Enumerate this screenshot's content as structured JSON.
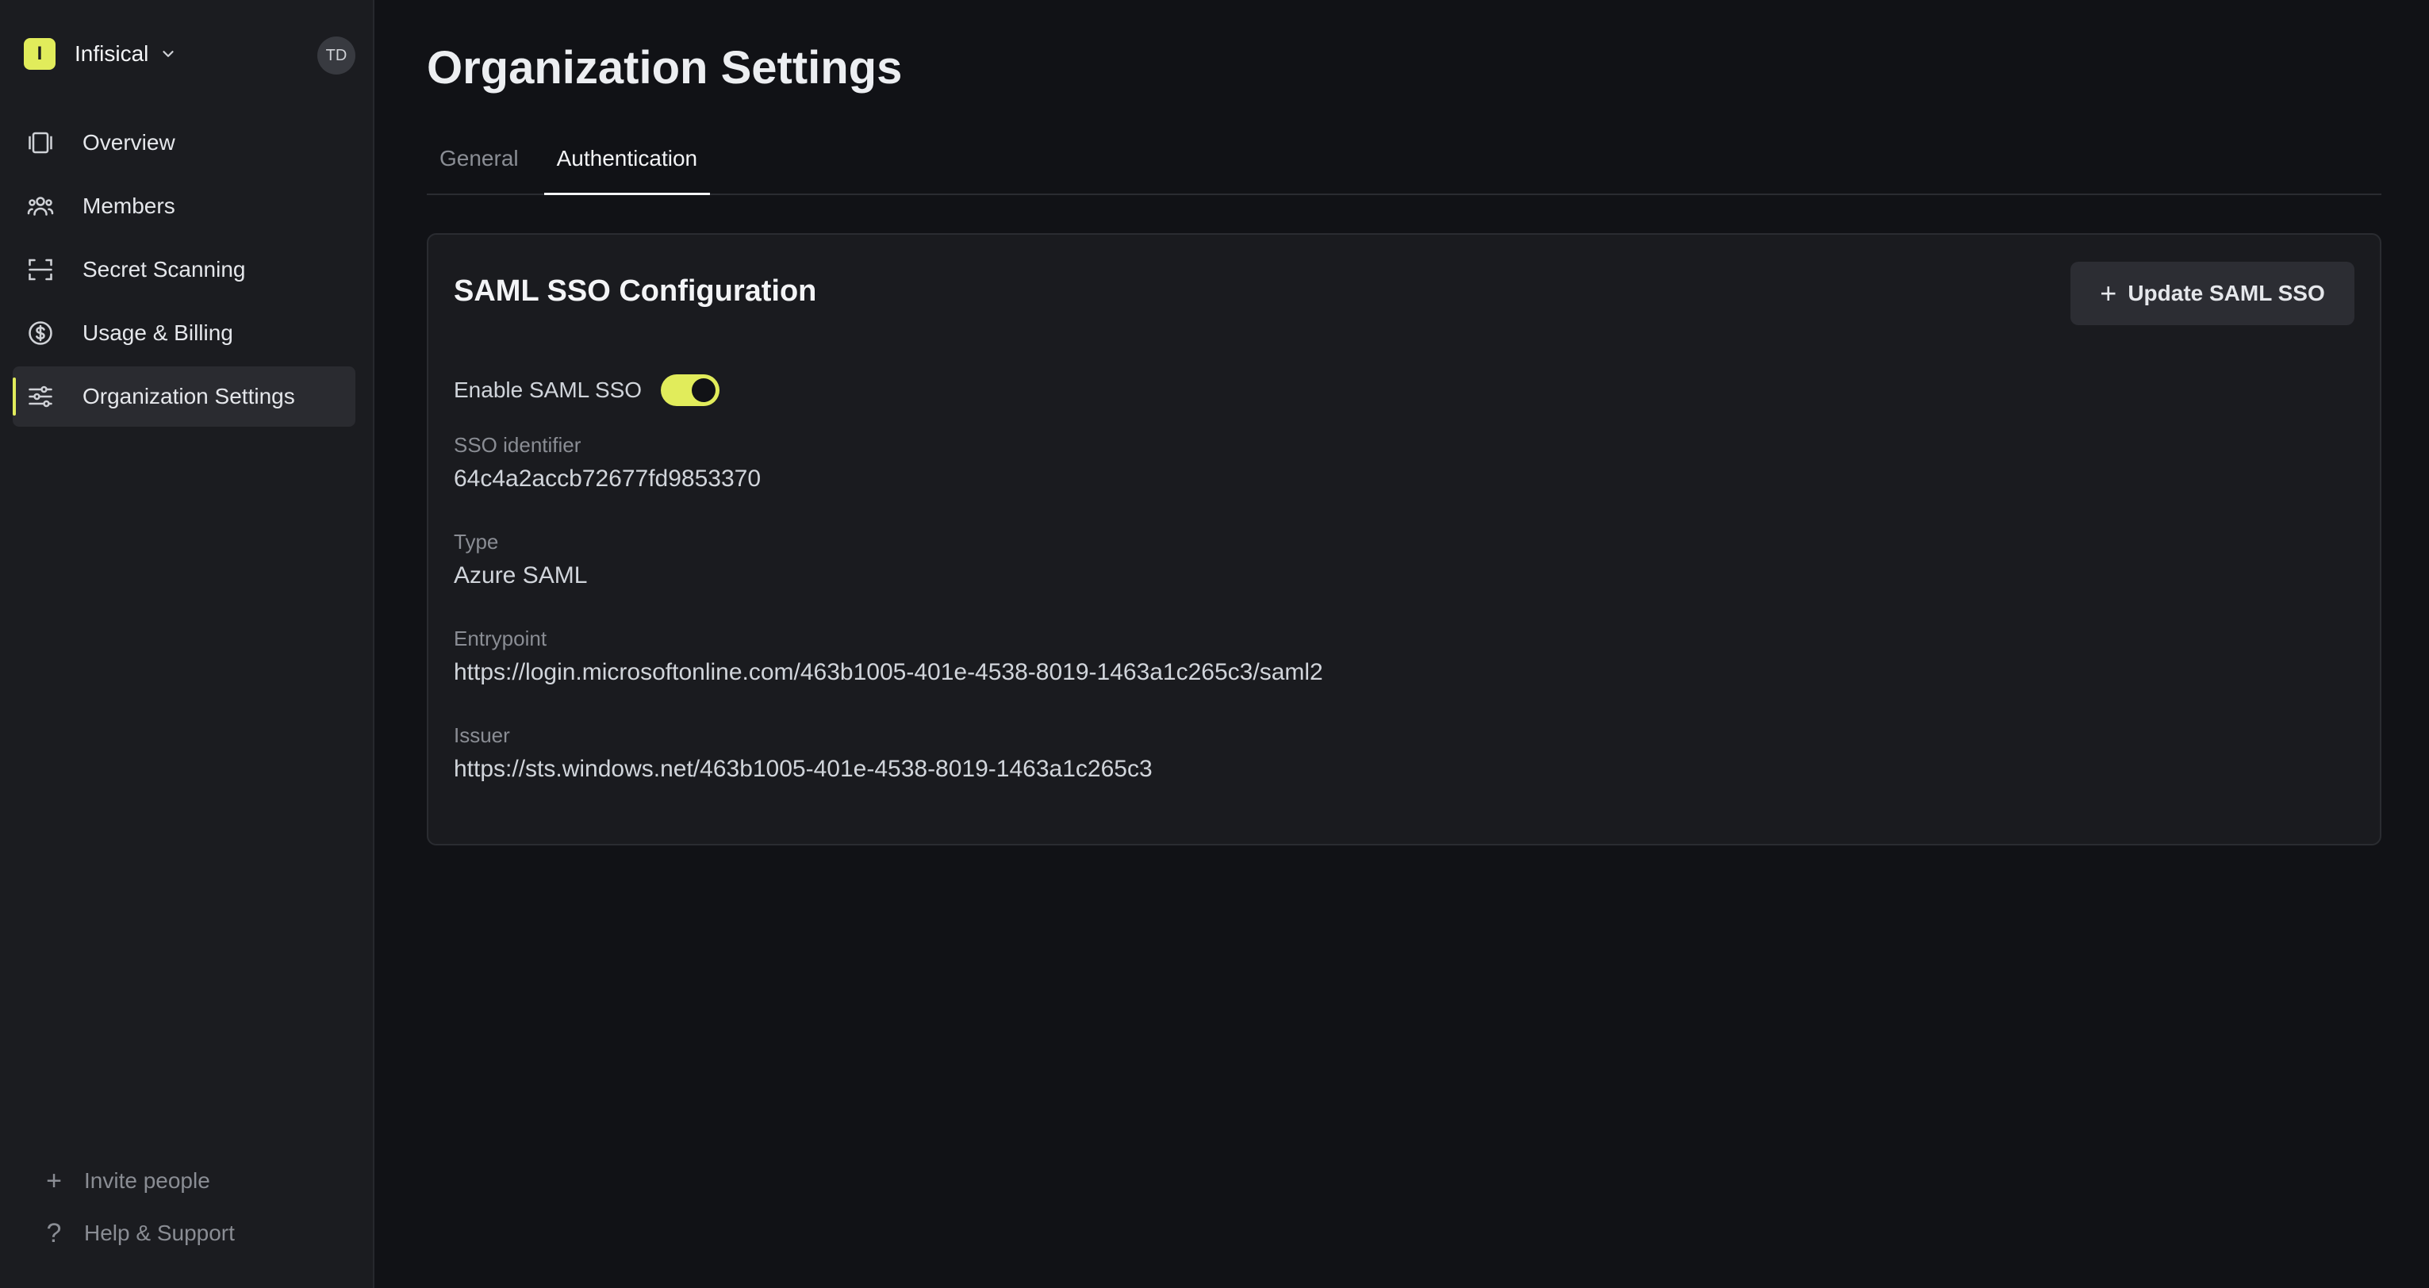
{
  "sidebar": {
    "org": {
      "badge": "I",
      "name": "Infisical"
    },
    "avatar": "TD",
    "items": [
      {
        "label": "Overview",
        "icon": "overview-icon"
      },
      {
        "label": "Members",
        "icon": "members-icon"
      },
      {
        "label": "Secret Scanning",
        "icon": "scan-icon"
      },
      {
        "label": "Usage & Billing",
        "icon": "dollar-icon"
      },
      {
        "label": "Organization Settings",
        "icon": "settings-sliders-icon",
        "active": true
      }
    ],
    "bottom": {
      "invite": "Invite people",
      "help": "Help & Support"
    }
  },
  "main": {
    "title": "Organization Settings",
    "tabs": [
      {
        "label": "General"
      },
      {
        "label": "Authentication",
        "active": true
      }
    ],
    "card": {
      "title": "SAML SSO Configuration",
      "button": "Update SAML SSO",
      "toggle_label": "Enable SAML SSO",
      "toggle_on": true,
      "fields": [
        {
          "label": "SSO identifier",
          "value": "64c4a2accb72677fd9853370"
        },
        {
          "label": "Type",
          "value": "Azure SAML"
        },
        {
          "label": "Entrypoint",
          "value": "https://login.microsoftonline.com/463b1005-401e-4538-8019-1463a1c265c3/saml2"
        },
        {
          "label": "Issuer",
          "value": "https://sts.windows.net/463b1005-401e-4538-8019-1463a1c265c3"
        }
      ]
    }
  },
  "colors": {
    "accent": "#e1ec5b",
    "background": "#111216",
    "sidebar": "#1b1c20",
    "card": "#1a1b1f"
  }
}
